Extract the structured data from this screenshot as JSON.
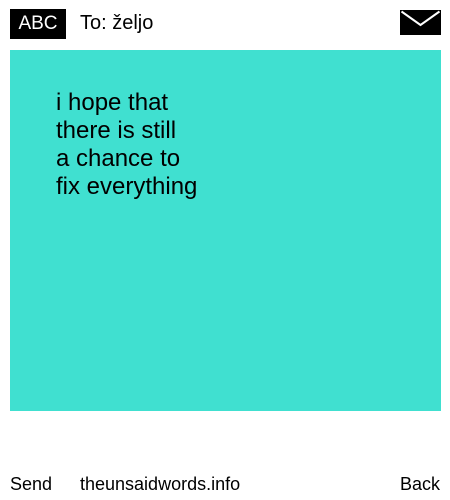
{
  "header": {
    "badge_label": "ABC",
    "recipient": "To: željo",
    "envelope_icon": "envelope-icon"
  },
  "note": {
    "background_color": "#40e0d0",
    "lines": [
      "i hope that",
      "there is still",
      "a chance to",
      "fix everything"
    ]
  },
  "footer": {
    "send_label": "Send",
    "site_label": "theunsaidwords.info",
    "back_label": "Back"
  }
}
